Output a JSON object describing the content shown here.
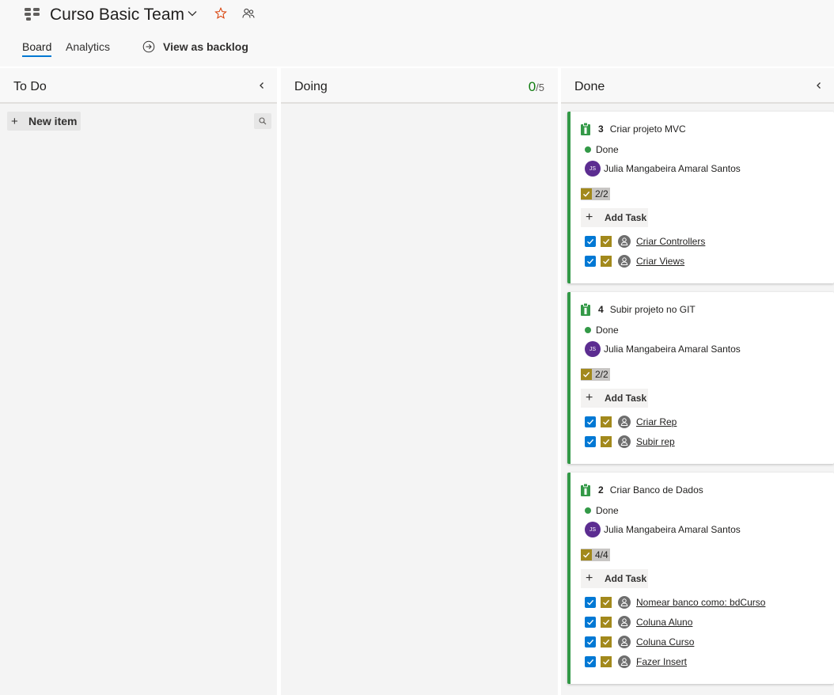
{
  "header": {
    "team_name": "Curso Basic Team",
    "tabs": [
      {
        "label": "Board"
      },
      {
        "label": "Analytics"
      }
    ],
    "backlog_link": "View as backlog"
  },
  "columns": [
    {
      "name": "To Do",
      "new_item_label": "New item"
    },
    {
      "name": "Doing",
      "wip_current": "0",
      "wip_limit": "/5"
    },
    {
      "name": "Done"
    }
  ],
  "colors": {
    "accent": "#0078d4",
    "done_green": "#339947",
    "task_gold": "#a2891c",
    "avatar_purple": "#5c2d91"
  },
  "cards": [
    {
      "id": "3",
      "title": "Criar projeto MVC",
      "state": "Done",
      "assignee_initials": "JS",
      "assignee": "Julia Mangabeira Amaral Santos",
      "progress": "2/2",
      "add_task_label": "Add Task",
      "tasks": [
        {
          "title": "Criar Controllers"
        },
        {
          "title": "Criar Views"
        }
      ]
    },
    {
      "id": "4",
      "title": "Subir projeto no GIT",
      "state": "Done",
      "assignee_initials": "JS",
      "assignee": "Julia Mangabeira Amaral Santos",
      "progress": "2/2",
      "add_task_label": "Add Task",
      "tasks": [
        {
          "title": "Criar Rep"
        },
        {
          "title": "Subir rep"
        }
      ]
    },
    {
      "id": "2",
      "title": "Criar Banco de Dados",
      "state": "Done",
      "assignee_initials": "JS",
      "assignee": "Julia Mangabeira Amaral Santos",
      "progress": "4/4",
      "add_task_label": "Add Task",
      "tasks": [
        {
          "title": "Nomear banco como: bdCurso"
        },
        {
          "title": "Coluna Aluno"
        },
        {
          "title": "Coluna Curso"
        },
        {
          "title": "Fazer Insert"
        }
      ]
    }
  ]
}
